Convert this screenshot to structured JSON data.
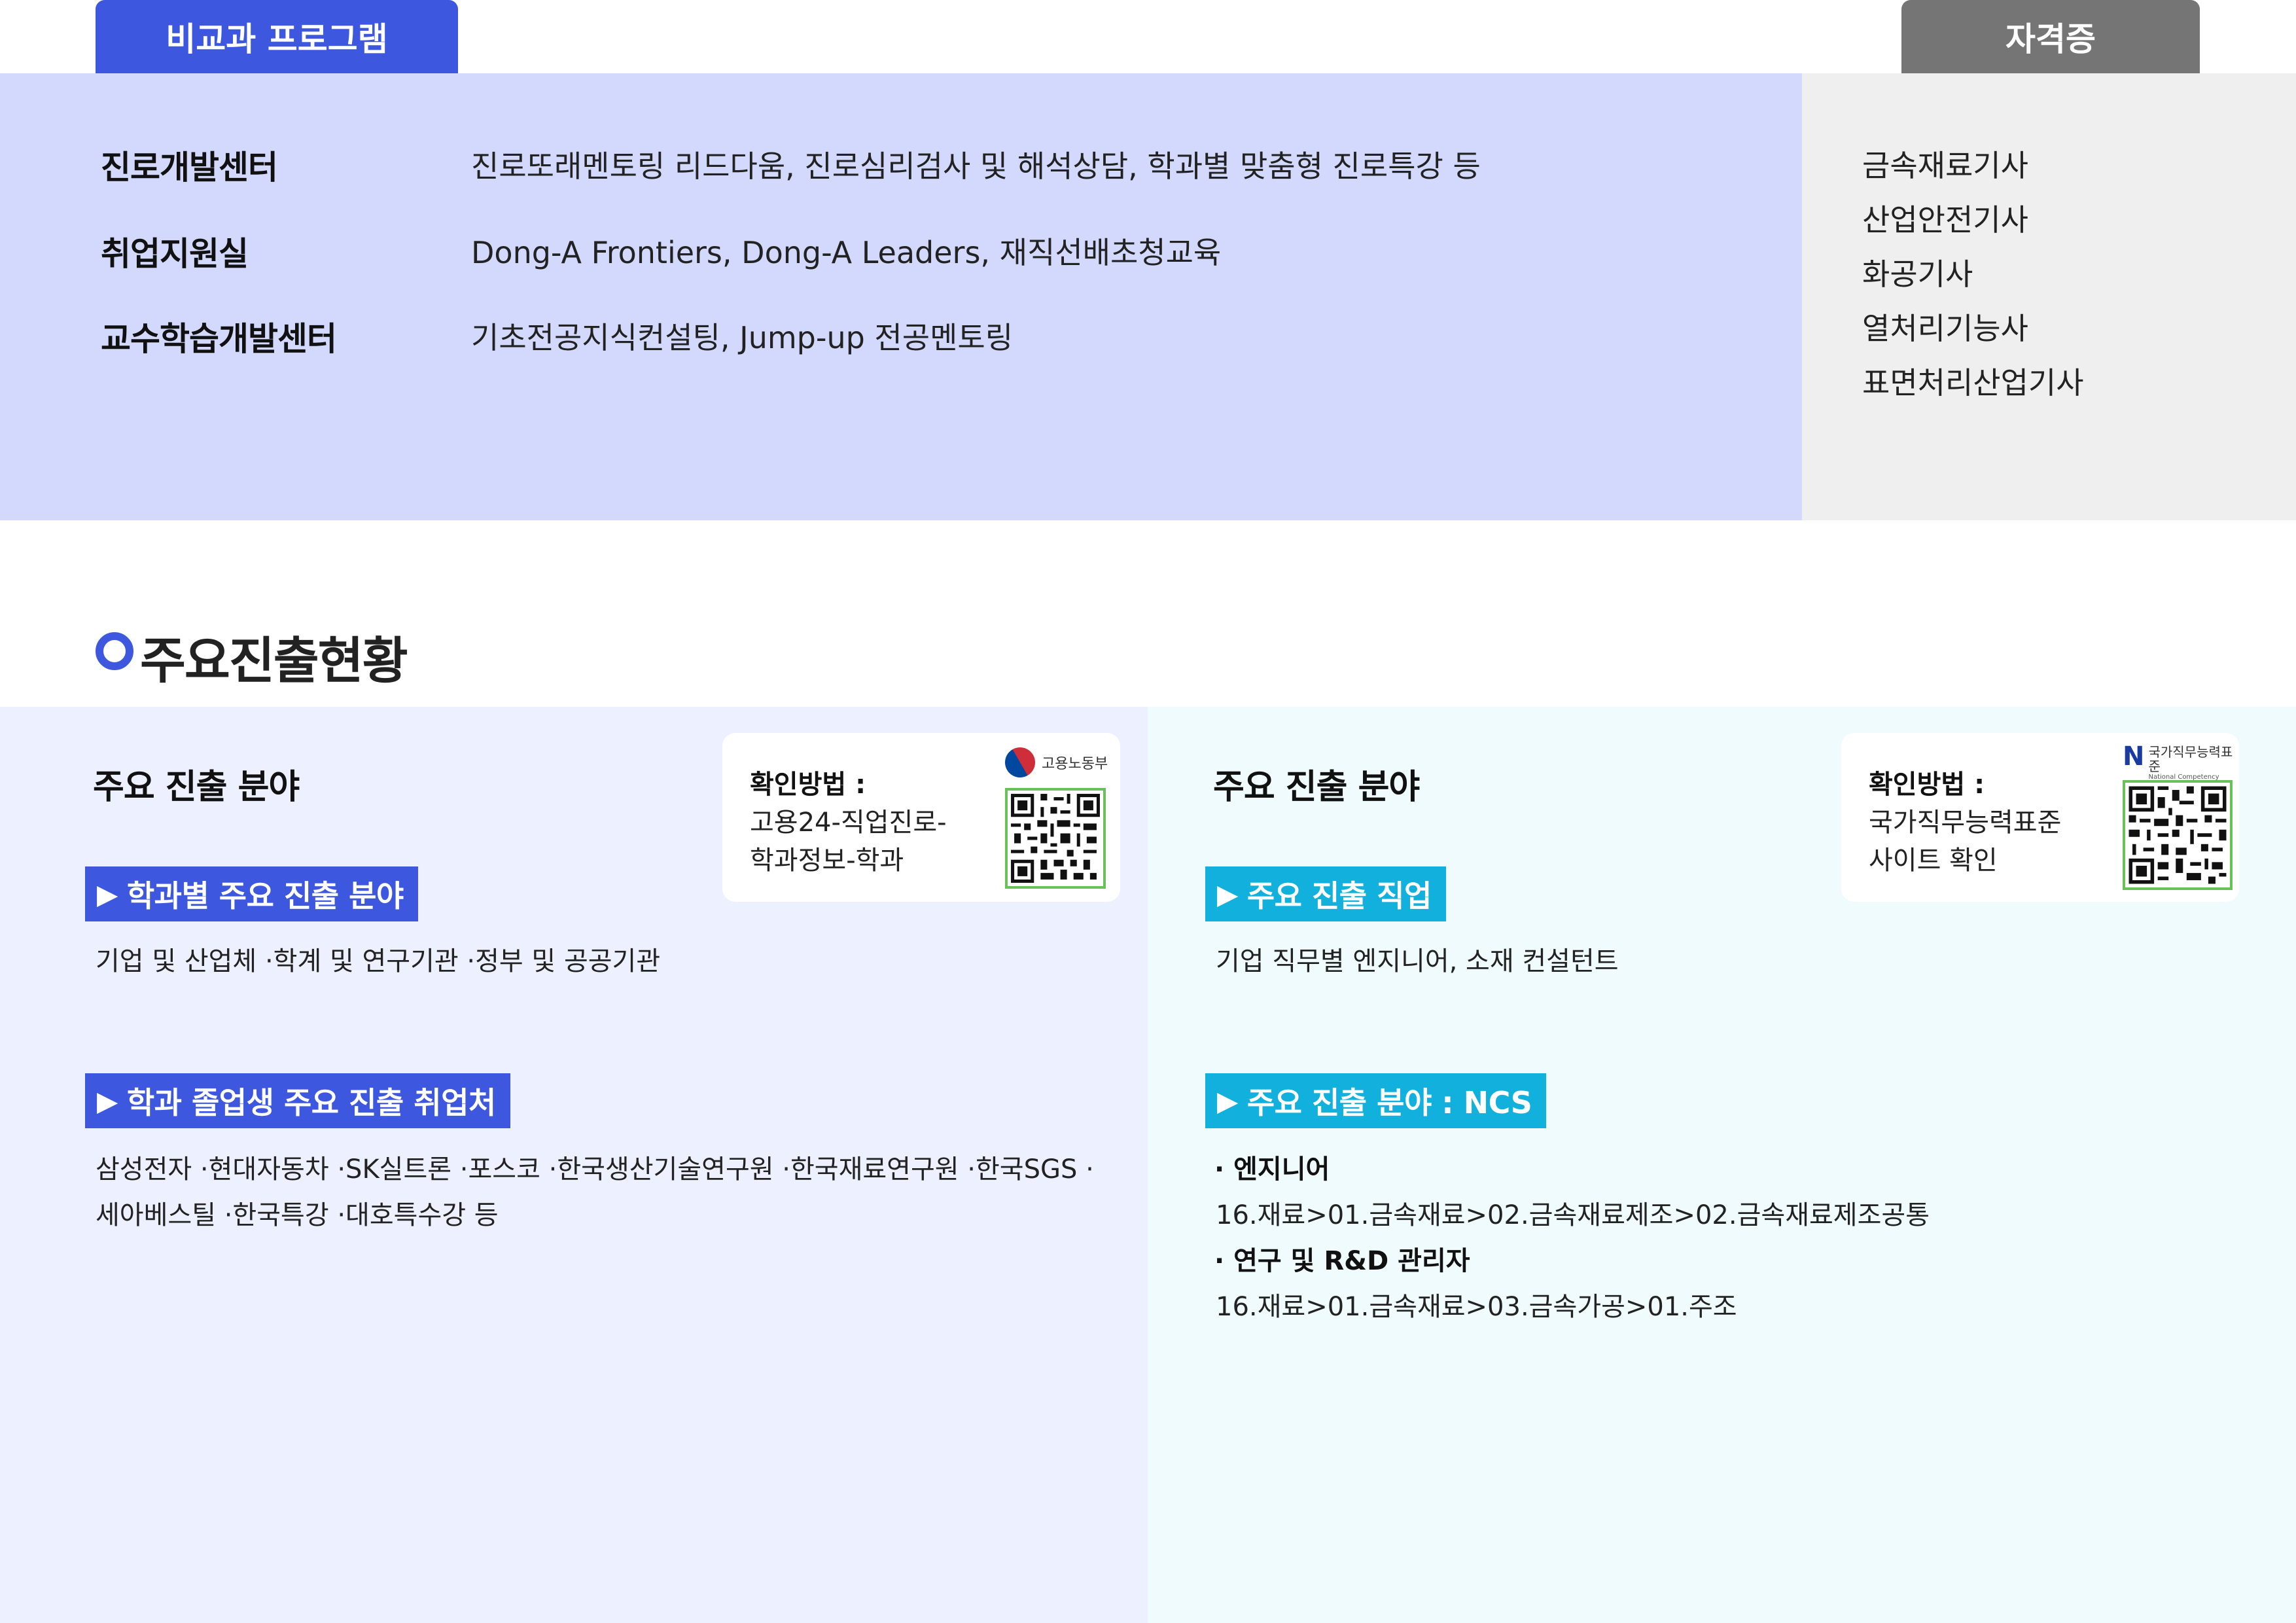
{
  "tabs": {
    "nonsubject": "비교과 프로그램",
    "certificate": "자격증"
  },
  "programs": [
    {
      "name": "진로개발센터",
      "desc": "진로또래멘토링 리드다움, 진로심리검사 및 해석상담, 학과별 맞춤형 진로특강 등"
    },
    {
      "name": "취업지원실",
      "desc": "Dong-A Frontiers, Dong-A Leaders, 재직선배초청교육"
    },
    {
      "name": "교수학습개발센터",
      "desc": "기초전공지식컨설팅, Jump-up 전공멘토링"
    }
  ],
  "certificates": [
    "금속재료기사",
    "산업안전기사",
    "화공기사",
    "열처리기능사",
    "표면처리산업기사"
  ],
  "section_title": "주요진출현황",
  "left": {
    "heading": "주요 진출 분야",
    "qr": {
      "title": "확인방법 :",
      "lines": [
        "고용24-직업진로-",
        "학과정보-학과"
      ],
      "logo_text": "고용노동부"
    },
    "tag1": "학과별 주요 진출 분야",
    "text1": "기업 및 산업체 ·학계 및 연구기관 ·정부 및 공공기관",
    "tag2": "학과 졸업생 주요 진출 취업처",
    "text2_lines": [
      "삼성전자 ·현대자동차 ·SK실트론 ·포스코 ·한국생산기술연구원 ·한국재료연구원 ·한국SGS ·",
      "세아베스틸 ·한국특강 ·대호특수강 등"
    ]
  },
  "right": {
    "heading": "주요 진출 분야",
    "qr": {
      "title": "확인방법 :",
      "lines": [
        "국가직무능력표준",
        "사이트 확인"
      ],
      "logo_text": "국가직무능력표준",
      "logo_sub": "National Competency Standards"
    },
    "tag1": "주요 진출 직업",
    "text1": "기업 직무별 엔지니어, 소재 컨설턴트",
    "tag2": "주요 진출 분야 : NCS",
    "ncs": [
      {
        "label": "· 엔지니어",
        "path": "16.재료>01.금속재료>02.금속재료제조>02.금속재료제조공통"
      },
      {
        "label": "· 연구 및 R&D 관리자",
        "path": "16.재료>01.금속재료>03.금속가공>01.주조"
      }
    ]
  },
  "icons": {
    "tag_arrow": "▶",
    "section_marker": "ring-icon",
    "qr": "qr-code-icon"
  },
  "colors": {
    "primary_blue": "#3d57de",
    "cyan": "#12b0dc",
    "cert_tab_gray": "#757575",
    "program_bg": "#d3d8fd",
    "cert_bg": "#efefef",
    "left_bg": "#edf0fe",
    "right_bg": "#f0fbfd",
    "qr_border": "#69c15a"
  }
}
